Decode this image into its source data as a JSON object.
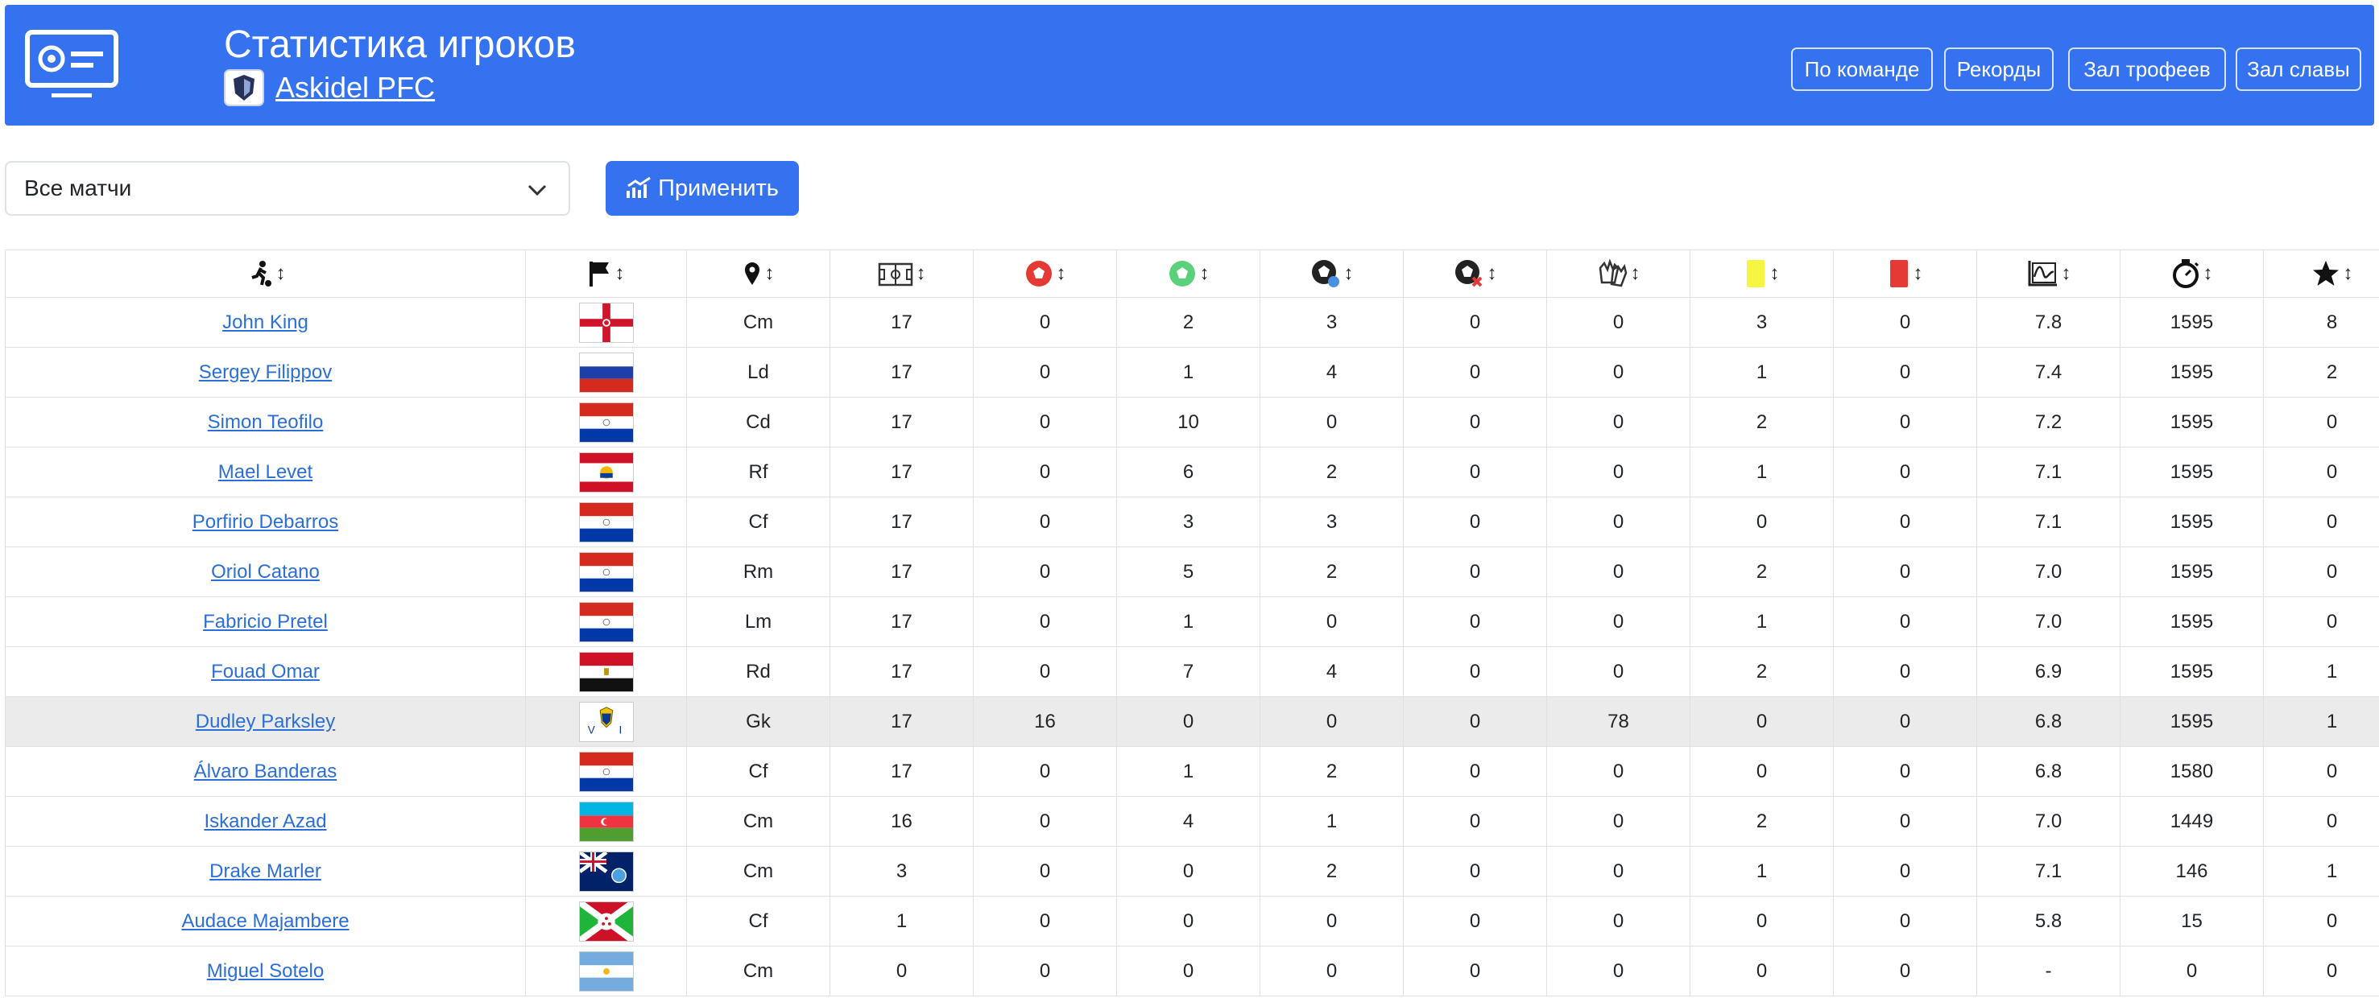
{
  "header": {
    "title": "Статистика игроков",
    "team_name": "Askidel PFC",
    "nav": [
      "По команде",
      "Рекорды",
      "Зал трофеев",
      "Зал славы"
    ]
  },
  "filter": {
    "selected": "Все матчи"
  },
  "apply_label": "Применить",
  "table": {
    "columns": [
      {
        "icon": "player-running-icon"
      },
      {
        "icon": "flag-icon"
      },
      {
        "icon": "location-pin-icon"
      },
      {
        "icon": "matches-field-icon"
      },
      {
        "icon": "goals-conceded-ball-icon"
      },
      {
        "icon": "goals-scored-ball-icon"
      },
      {
        "icon": "assist-ball-icon"
      },
      {
        "icon": "own-goal-ball-icon"
      },
      {
        "icon": "saves-gloves-icon"
      },
      {
        "icon": "yellow-card-icon"
      },
      {
        "icon": "red-card-icon"
      },
      {
        "icon": "rating-chart-icon"
      },
      {
        "icon": "minutes-stopwatch-icon"
      },
      {
        "icon": "best-player-star-icon"
      }
    ],
    "sort_glyph": "↕",
    "rows": [
      {
        "name": "John King",
        "flag": "northern-ireland",
        "pos": "Cm",
        "c": [
          "17",
          "0",
          "2",
          "3",
          "0",
          "0",
          "3",
          "0",
          "7.8",
          "1595",
          "8"
        ]
      },
      {
        "name": "Sergey Filippov",
        "flag": "russia",
        "pos": "Ld",
        "c": [
          "17",
          "0",
          "1",
          "4",
          "0",
          "0",
          "1",
          "0",
          "7.4",
          "1595",
          "2"
        ]
      },
      {
        "name": "Simon Teofilo",
        "flag": "paraguay",
        "pos": "Cd",
        "c": [
          "17",
          "0",
          "10",
          "0",
          "0",
          "0",
          "2",
          "0",
          "7.2",
          "1595",
          "0"
        ]
      },
      {
        "name": "Mael Levet",
        "flag": "french-polynesia",
        "pos": "Rf",
        "c": [
          "17",
          "0",
          "6",
          "2",
          "0",
          "0",
          "1",
          "0",
          "7.1",
          "1595",
          "0"
        ]
      },
      {
        "name": "Porfirio Debarros",
        "flag": "paraguay",
        "pos": "Cf",
        "c": [
          "17",
          "0",
          "3",
          "3",
          "0",
          "0",
          "0",
          "0",
          "7.1",
          "1595",
          "0"
        ]
      },
      {
        "name": "Oriol Catano",
        "flag": "paraguay",
        "pos": "Rm",
        "c": [
          "17",
          "0",
          "5",
          "2",
          "0",
          "0",
          "2",
          "0",
          "7.0",
          "1595",
          "0"
        ]
      },
      {
        "name": "Fabricio Pretel",
        "flag": "paraguay",
        "pos": "Lm",
        "c": [
          "17",
          "0",
          "1",
          "0",
          "0",
          "0",
          "1",
          "0",
          "7.0",
          "1595",
          "0"
        ]
      },
      {
        "name": "Fouad Omar",
        "flag": "egypt",
        "pos": "Rd",
        "c": [
          "17",
          "0",
          "7",
          "4",
          "0",
          "0",
          "2",
          "0",
          "6.9",
          "1595",
          "1"
        ]
      },
      {
        "name": "Dudley Parksley",
        "flag": "us-virgin-islands",
        "pos": "Gk",
        "c": [
          "17",
          "16",
          "0",
          "0",
          "0",
          "78",
          "0",
          "0",
          "6.8",
          "1595",
          "1"
        ],
        "selected": true
      },
      {
        "name": "Álvaro Banderas",
        "flag": "paraguay",
        "pos": "Cf",
        "c": [
          "17",
          "0",
          "1",
          "2",
          "0",
          "0",
          "0",
          "0",
          "6.8",
          "1580",
          "0"
        ]
      },
      {
        "name": "Iskander Azad",
        "flag": "azerbaijan",
        "pos": "Cm",
        "c": [
          "16",
          "0",
          "4",
          "1",
          "0",
          "0",
          "2",
          "0",
          "7.0",
          "1449",
          "0"
        ]
      },
      {
        "name": "Drake Marler",
        "flag": "falkland-islands",
        "pos": "Cm",
        "c": [
          "3",
          "0",
          "0",
          "2",
          "0",
          "0",
          "1",
          "0",
          "7.1",
          "146",
          "1"
        ]
      },
      {
        "name": "Audace Majambere",
        "flag": "burundi",
        "pos": "Cf",
        "c": [
          "1",
          "0",
          "0",
          "0",
          "0",
          "0",
          "0",
          "0",
          "5.8",
          "15",
          "0"
        ]
      },
      {
        "name": "Miguel Sotelo",
        "flag": "argentina",
        "pos": "Cm",
        "c": [
          "0",
          "0",
          "0",
          "0",
          "0",
          "0",
          "0",
          "0",
          "-",
          "0",
          "0"
        ]
      }
    ]
  }
}
